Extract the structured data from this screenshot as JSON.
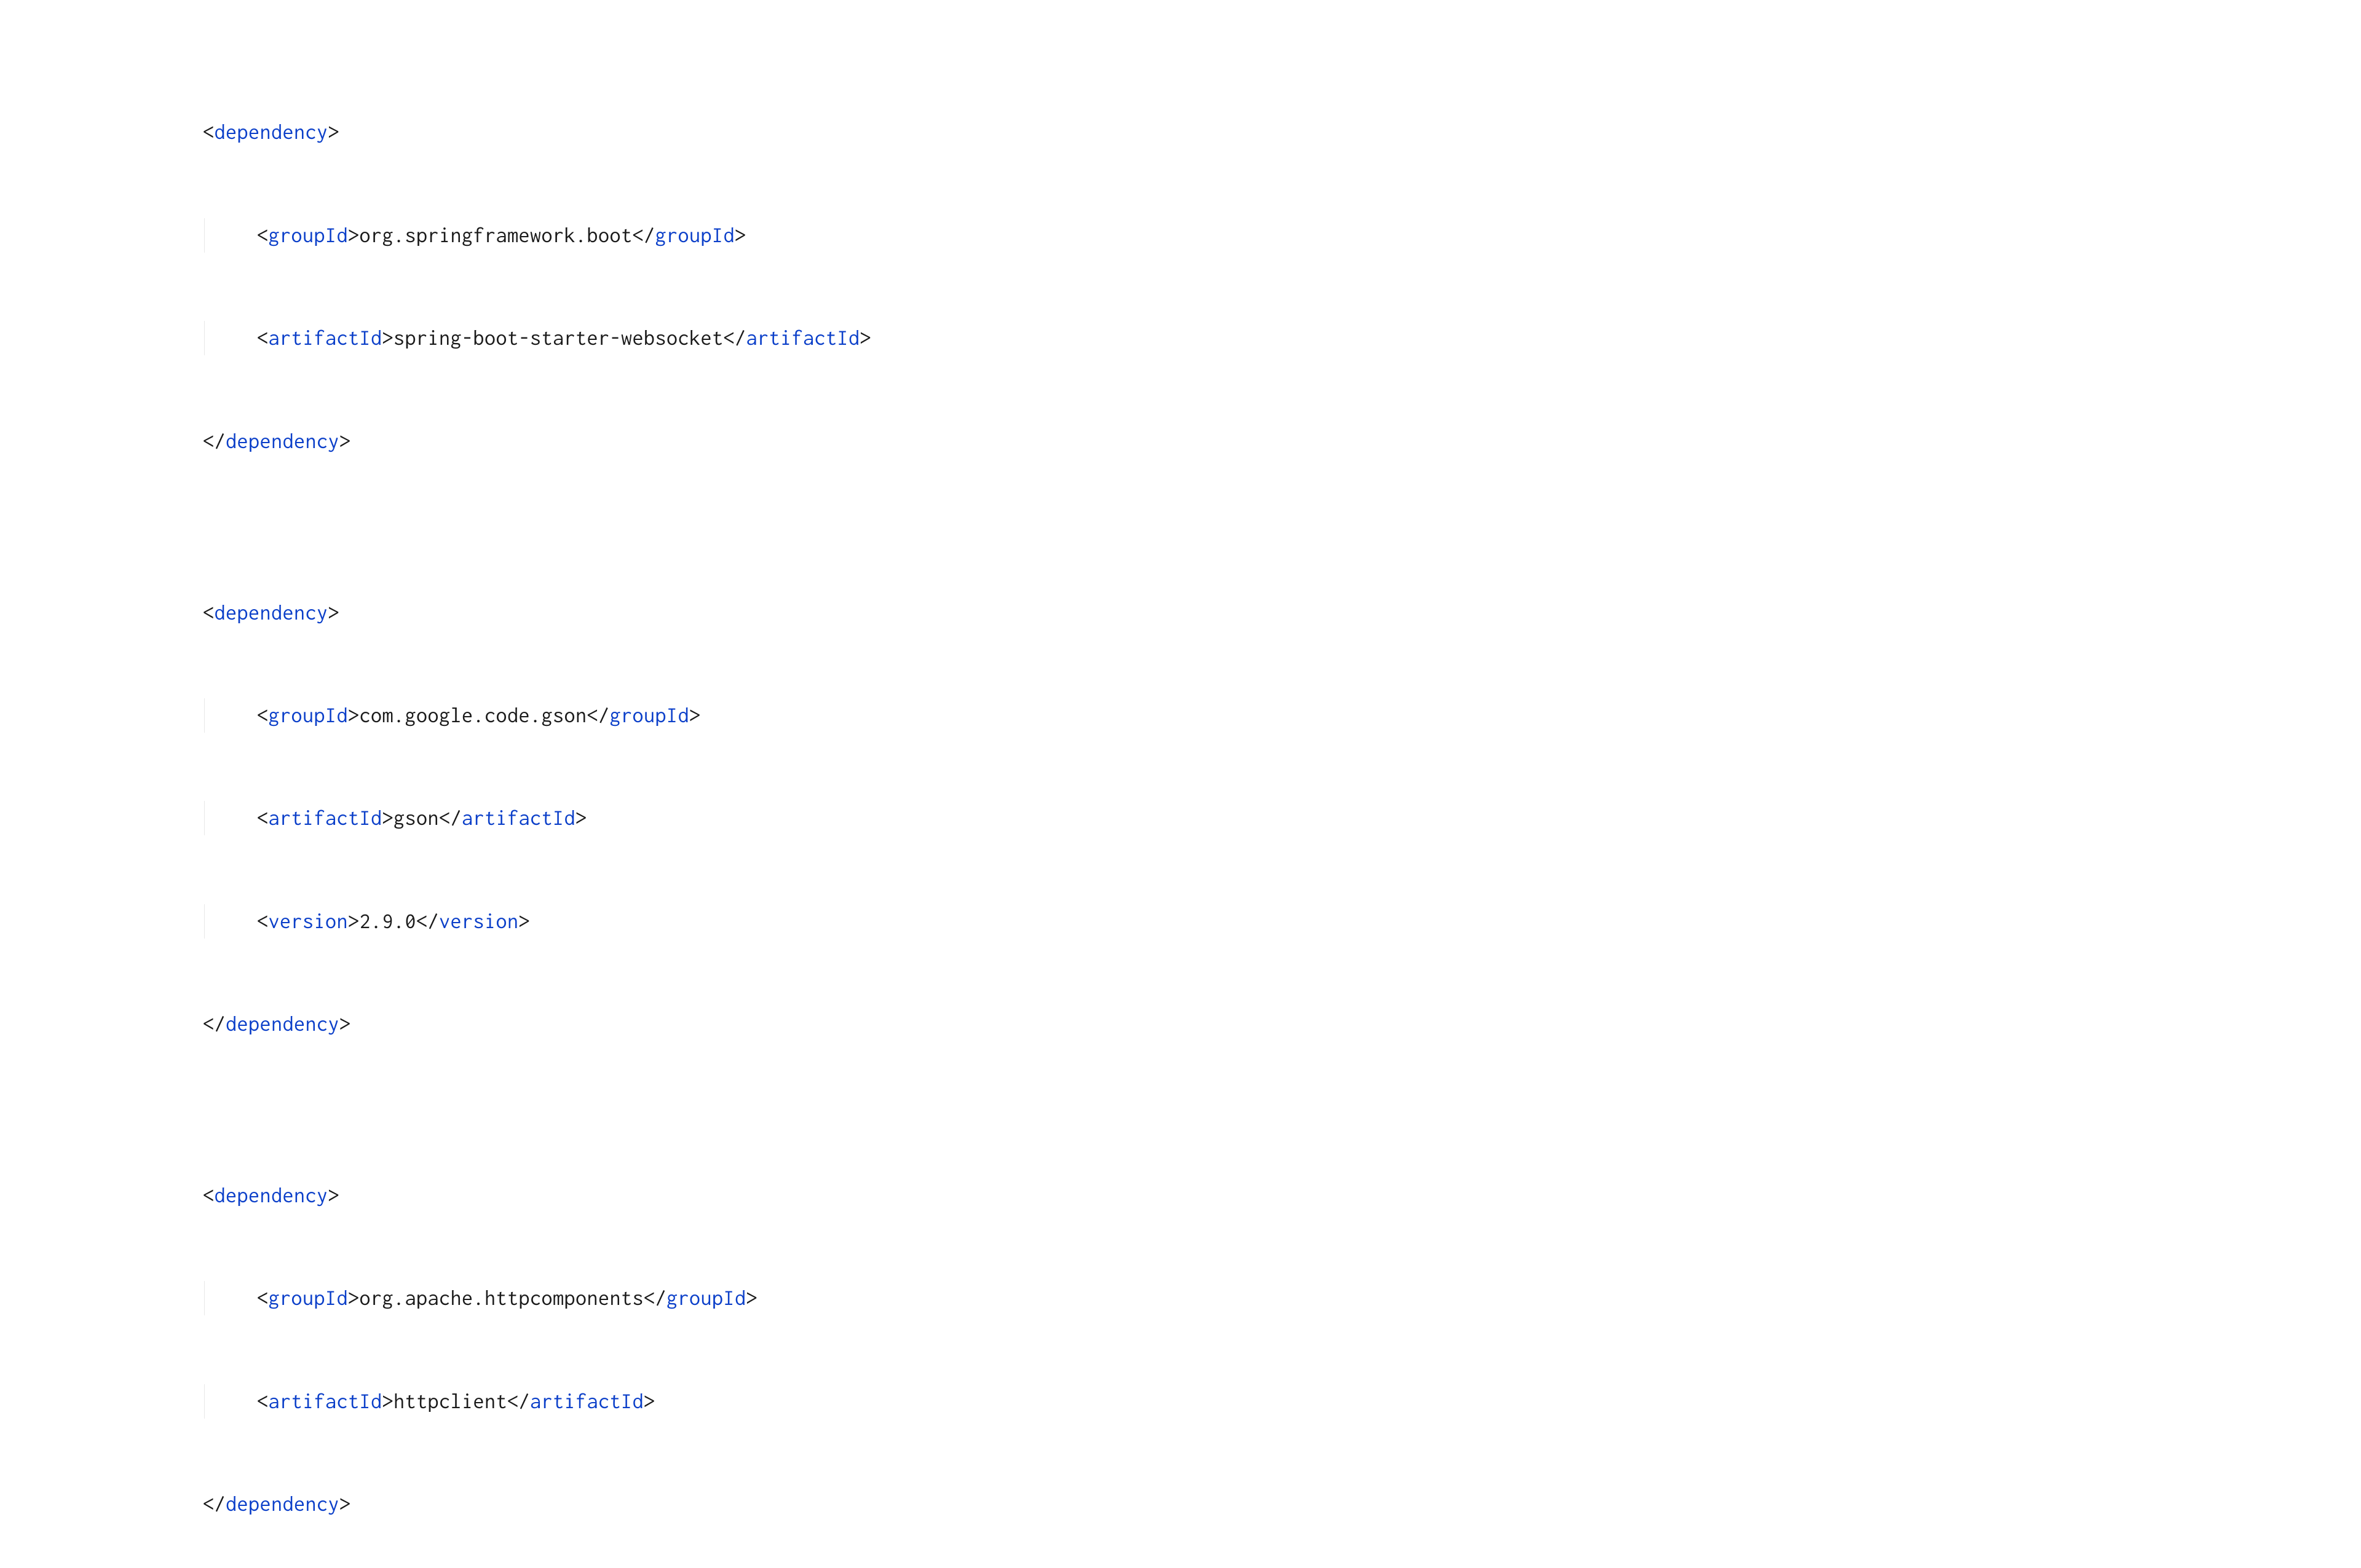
{
  "tags": {
    "dependency_open": "dependency",
    "dependency_close": "dependency",
    "groupId_open": "groupId",
    "groupId_close": "groupId",
    "artifactId_open": "artifactId",
    "artifactId_close": "artifactId",
    "version_open": "version",
    "version_close": "version"
  },
  "dependencies": [
    {
      "groupId": "org.springframework.boot",
      "artifactId": "spring-boot-starter-websocket"
    },
    {
      "groupId": "com.google.code.gson",
      "artifactId": "gson",
      "version": "2.9.0"
    },
    {
      "groupId": "org.apache.httpcomponents",
      "artifactId": "httpclient"
    }
  ]
}
